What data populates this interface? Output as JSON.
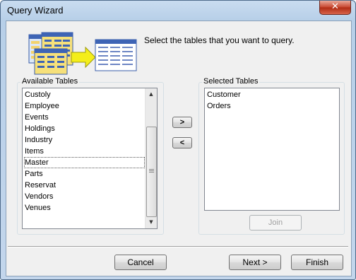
{
  "window": {
    "title": "Query Wizard",
    "close_label": "✕"
  },
  "header": {
    "instruction": "Select the tables that you want to query."
  },
  "available": {
    "label": "Available Tables",
    "items": [
      "Custoly",
      "Employee",
      "Events",
      "Holdings",
      "Industry",
      "Items",
      "Master",
      "Parts",
      "Reservat",
      "Vendors",
      "Venues"
    ],
    "focused_item": "Master"
  },
  "selected": {
    "label": "Selected Tables",
    "items": [
      "Customer",
      "Orders"
    ]
  },
  "buttons": {
    "add": ">",
    "remove": "<",
    "join": "Join",
    "cancel": "Cancel",
    "next": "Next >",
    "finish": "Finish"
  },
  "icons": {
    "scroll_up": "▲",
    "scroll_down": "▼"
  }
}
